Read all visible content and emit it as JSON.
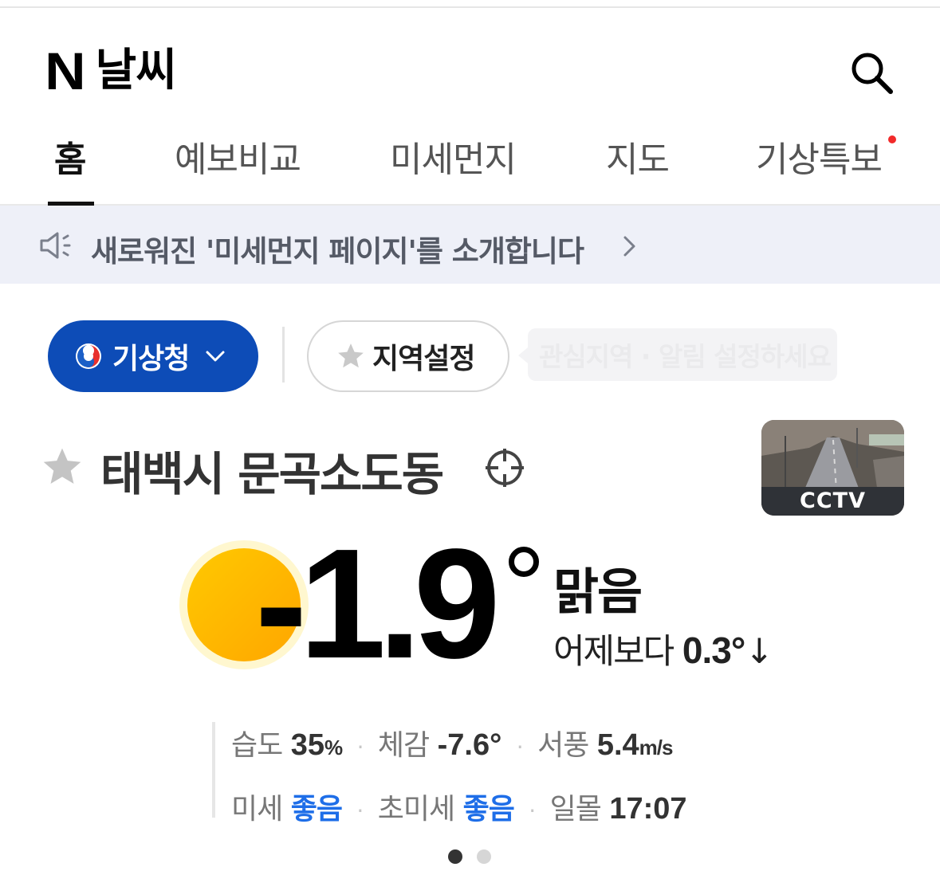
{
  "header": {
    "logo": "N",
    "title": "날씨",
    "search_icon": "search-icon"
  },
  "tabs": [
    {
      "label": "홈",
      "active": true
    },
    {
      "label": "예보비교",
      "active": false
    },
    {
      "label": "미세먼지",
      "active": false
    },
    {
      "label": "지도",
      "active": false
    },
    {
      "label": "기상특보",
      "active": false,
      "badge": "new-dot"
    }
  ],
  "notice": {
    "icon": "megaphone-icon",
    "text": "새로워진 '미세먼지 페이지'를 소개합니다"
  },
  "source": {
    "label": "기상청",
    "icon": "kma-logo"
  },
  "region": {
    "label": "지역설정",
    "tooltip": "관심지역 · 알림 설정하세요"
  },
  "location": {
    "name": "태백시 문곡소도동"
  },
  "cctv": {
    "label": "CCTV"
  },
  "current": {
    "temperature": "-1.9",
    "condition": "맑음",
    "compare_prefix": "어제보다",
    "compare_value": "0.3°",
    "compare_direction": "↓"
  },
  "details": {
    "humidity_label": "습도",
    "humidity_value": "35",
    "humidity_unit": "%",
    "feels_label": "체감",
    "feels_value": "-7.6°",
    "wind_label": "서풍",
    "wind_value": "5.4",
    "wind_unit": "m/s",
    "pm10_label": "미세",
    "pm10_value": "좋음",
    "pm25_label": "초미세",
    "pm25_value": "좋음",
    "sunset_label": "일몰",
    "sunset_value": "17:07"
  },
  "pager": {
    "count": 2,
    "active": 0
  },
  "colors": {
    "accent_blue": "#0d4cb7",
    "good_blue": "#1e6ee8",
    "notice_bg": "#eef0f8",
    "alert_red": "#f22a2a",
    "sun": "#ffbd00"
  }
}
